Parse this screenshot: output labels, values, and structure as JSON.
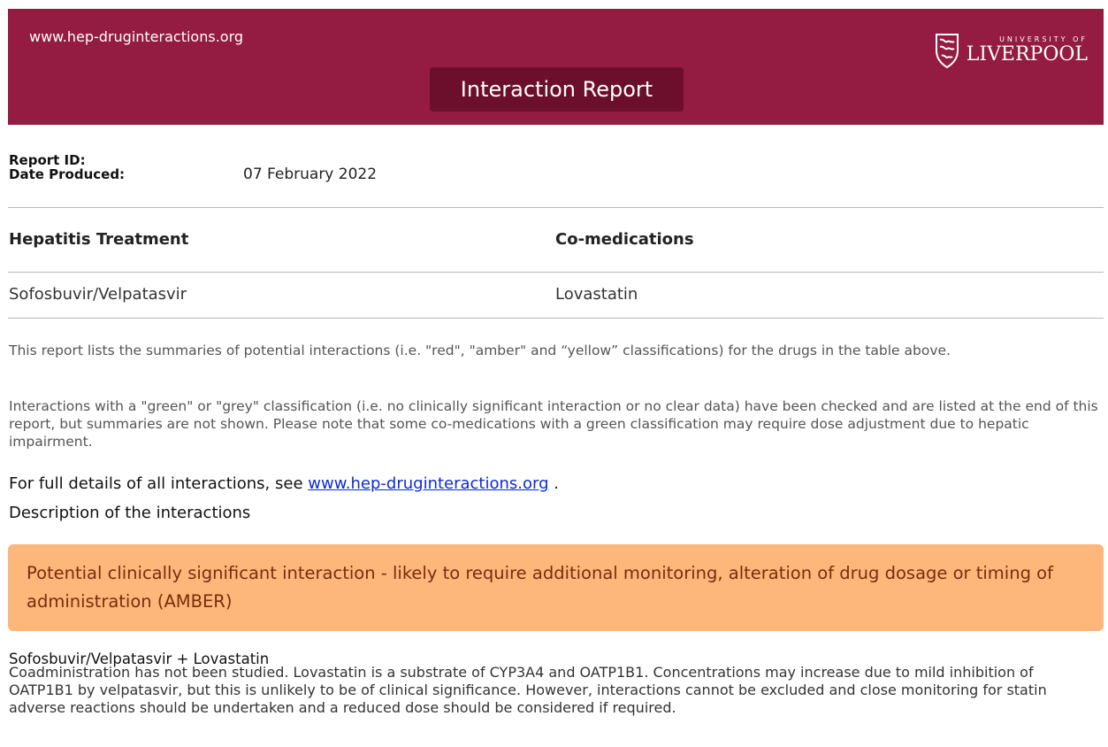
{
  "header": {
    "site_url": "www.hep-druginteractions.org",
    "title": "Interaction Report",
    "logo": {
      "small_text": "UNIVERSITY OF",
      "big_text": "LIVERPOOL"
    },
    "brand_color": "#941b42"
  },
  "meta": {
    "report_id_label": "Report ID:",
    "report_id_value": "",
    "date_label": "Date Produced:",
    "date_value": "07 February 2022"
  },
  "table": {
    "col1_header": "Hepatitis Treatment",
    "col2_header": "Co-medications",
    "rows": [
      {
        "treatment": "Sofosbuvir/Velpatasvir",
        "comedication": "Lovastatin"
      }
    ]
  },
  "intro": {
    "para1": "This report lists the summaries of potential interactions (i.e. \"red\", \"amber\" and “yellow” classifications) for the drugs in the table above.",
    "para2": "Interactions with a \"green\" or \"grey\" classification (i.e. no clinically significant interaction or no clear data) have been checked and are listed at the end of this report, but summaries are not shown. Please note that some co-medications with a green classification may require dose adjustment due to hepatic impairment.",
    "details_prefix": "For full details of all interactions, see",
    "details_link": "www.hep-druginteractions.org",
    "details_suffix": ".",
    "description_heading": "Description of the interactions"
  },
  "amber": {
    "text": "Potential clinically significant interaction - likely to require additional monitoring, alteration of drug dosage or timing of administration (AMBER)",
    "color": "#fdb77a"
  },
  "interaction": {
    "title": "Sofosbuvir/Velpatasvir + Lovastatin",
    "body": "Coadministration has not been studied. Lovastatin is a substrate of CYP3A4 and OATP1B1. Concentrations may increase due to mild inhibition of OATP1B1 by velpatasvir, but this is unlikely to be of clinical significance. However, interactions cannot be excluded and close monitoring for statin adverse reactions should be undertaken and a reduced dose should be considered if required."
  }
}
